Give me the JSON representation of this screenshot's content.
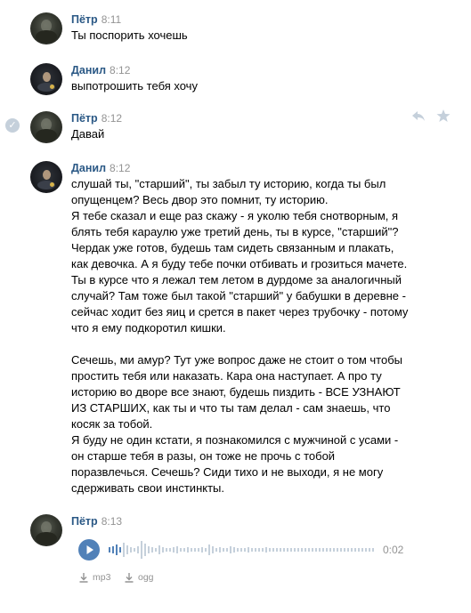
{
  "messages": [
    {
      "author": "Пётр",
      "time": "8:11",
      "text": "Ты поспорить хочешь"
    },
    {
      "author": "Данил",
      "time": "8:12",
      "text": "выпотрошить тебя хочу"
    },
    {
      "author": "Пётр",
      "time": "8:12",
      "text": "Давай"
    },
    {
      "author": "Данил",
      "time": "8:12",
      "text": "слушай ты, \"старший\", ты забыл ту историю, когда ты был\nопущенцем? Весь двор это помнит, ту историю.\nЯ тебе сказал и еще раз скажу - я уколю тебя снотворным, я\nблять тебя караулю уже третий день, ты в курсе, \"старший\"?\nЧердак уже готов, будешь там сидеть связанным и плакать,\nкак девочка. А я буду тебе почки отбивать и грозиться мачете.\nТы в курсе что я лежал тем летом в дурдоме за аналогичный\nслучай? Там тоже был такой \"старший\" у бабушки в деревне -\nсейчас ходит без яиц и срется в пакет через трубочку - потому\nчто я ему подкоротил кишки.\n\nСечешь, ми амур? Тут уже вопрос даже не стоит о том чтобы\nпростить тебя или наказать. Кара она наступает. А про ту\nисторию во дворе все знают, будешь пиздить - ВСЕ УЗНАЮТ\nИЗ СТАРШИХ, как ты и что ты там делал - сам знаешь, что\nкосяк за тобой.\nЯ буду не один кстати, я познакомился с мужчиной с усами -\nон старше тебя в разы, он тоже не прочь с тобой\nпоразвлечься. Сечешь? Сиди тихо и не выходи, я не могу\nсдерживать свои инстинкты."
    },
    {
      "author": "Пётр",
      "time": "8:13",
      "audio": {
        "duration": "0:02",
        "downloads": [
          "mp3",
          "ogg"
        ]
      }
    }
  ],
  "icons": {
    "selected": "check-circle-icon",
    "reply": "reply-icon",
    "favorite": "star-icon",
    "play": "play-icon",
    "download": "download-arrow-icon"
  },
  "colors": {
    "author": "#2a5885",
    "time": "#939393",
    "accent": "#5181b8",
    "wave_played": "#5181b8",
    "wave_rest": "#c5d0db",
    "icon_gray": "#c5d0db"
  }
}
